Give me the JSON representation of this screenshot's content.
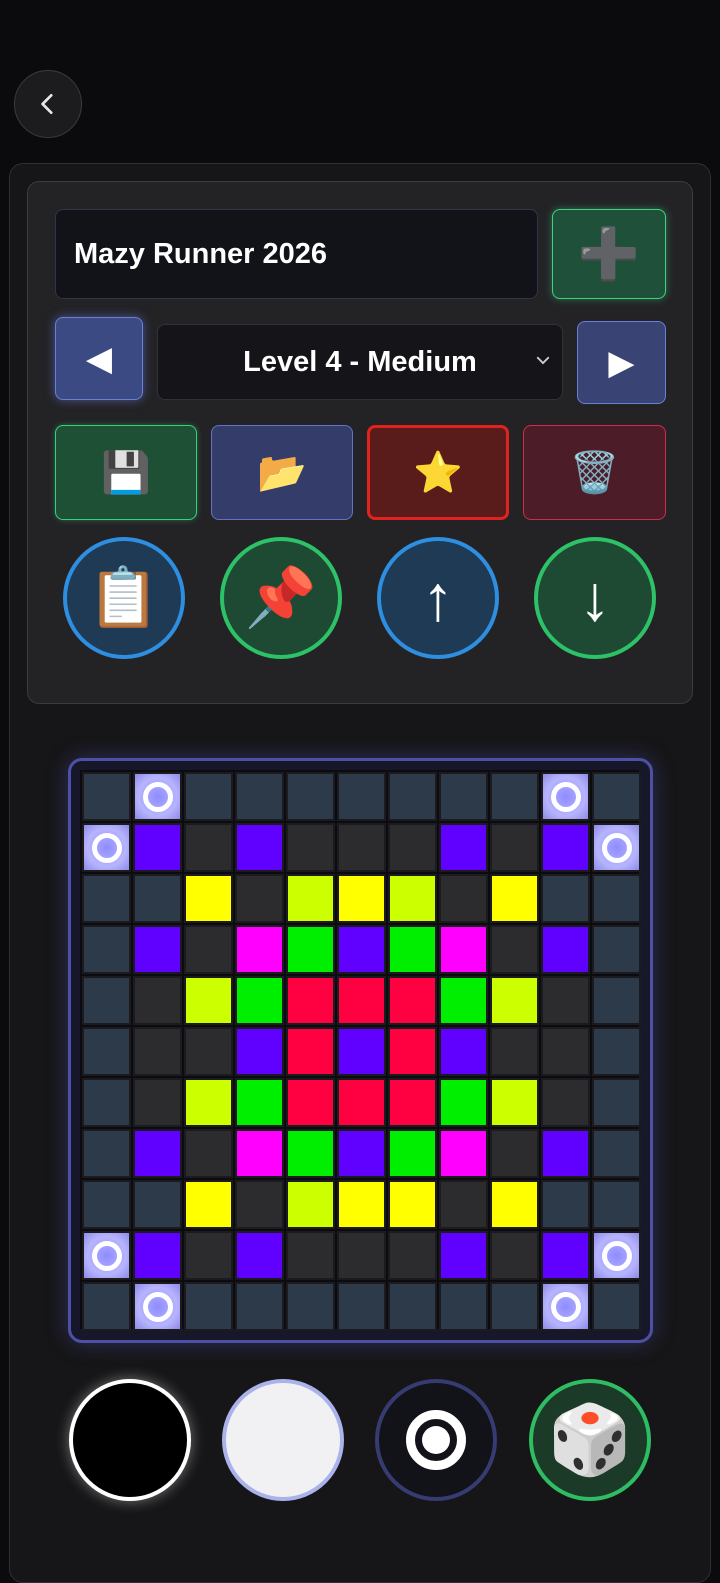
{
  "header": {
    "back_icon": "chevron-left-icon"
  },
  "editor": {
    "maze_name": "Mazy Runner 2026",
    "add_icon": "➕",
    "prev_icon": "◀",
    "next_icon": "▶",
    "level_selected": "Level 4 - Medium",
    "actions": {
      "save_icon": "💾",
      "open_icon": "📂",
      "star_icon": "⭐",
      "delete_icon": "🗑️"
    },
    "tools": {
      "clipboard_icon": "📋",
      "pin_icon": "📌",
      "up_icon": "↑",
      "down_icon": "↓"
    }
  },
  "board": {
    "size": 11,
    "palette": {
      "S": "#2d3a4a",
      "D": "#2c2c2e",
      "P": "#6000ff",
      "Y": "#ffff00",
      "L": "#ccff00",
      "M": "#ff00ff",
      "G": "#00ee00",
      "R": "#ff0040",
      "O": "#b7b5ff"
    },
    "rows": [
      "SOSSSSSSSOS",
      "OPDPDDDPDPO",
      "SSYDLYLDYSS",
      "SPDMGPGMDPS",
      "SDLGRRRGLDS",
      "SDDPRPRPDDS",
      "SDLGRRRGLDS",
      "SPDMGPGMDPS",
      "SSYDLYYDYSS",
      "OPDPDDDPDPO",
      "SOSSSSSSSOS"
    ]
  },
  "bottom_tools": {
    "color_black": "#000000",
    "color_white": "#f1f1f4",
    "dice_icon": "🎲"
  }
}
